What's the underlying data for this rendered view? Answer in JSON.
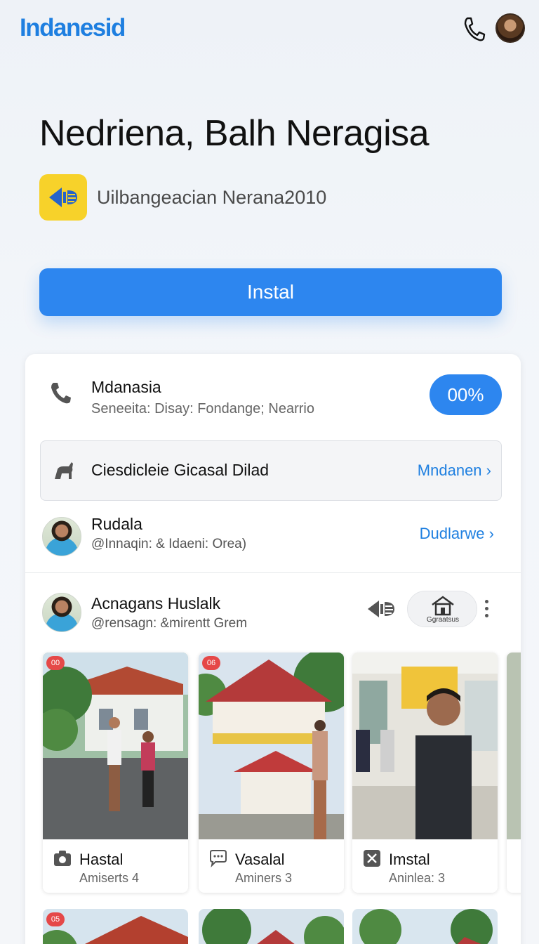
{
  "header": {
    "brand": "Indanesid",
    "icons": [
      "phone-icon",
      "profile-avatar"
    ]
  },
  "app": {
    "title": "Nedriena, Balh Neragisa",
    "developer": "Uilbangeacian Nerana2010",
    "install_label": "Instal"
  },
  "details": {
    "contact": {
      "title": "Mdanasia",
      "subtitle": "Seneeita: Disay: Fondange; Nearrio",
      "percent": "00%"
    },
    "category": {
      "title": "Ciesdicleie Gicasal Dilad",
      "link": "Mndanen"
    },
    "reviewer": {
      "name": "Rudala",
      "handle": "@Innaqin: & Idaeni: Orea)",
      "link": "Dudlarwe"
    },
    "post": {
      "name": "Acnagans Huslalk",
      "handle": "@rensagn: &mirentt Grem",
      "pill_label": "Ggraatsus"
    }
  },
  "gallery": [
    {
      "badge": "00",
      "title": "Hastal",
      "subtitle": "Amiserts 4",
      "icon": "camera-icon"
    },
    {
      "badge": "06",
      "title": "Vasalal",
      "subtitle": "Aminers 3",
      "icon": "chat-icon"
    },
    {
      "badge": "",
      "title": "Imstal",
      "subtitle": "Aninlea: 3",
      "icon": "close-box-icon"
    }
  ],
  "gallery_row2": [
    {
      "badge": "05"
    },
    {
      "badge": ""
    },
    {
      "badge": ""
    }
  ],
  "colors": {
    "accent": "#2d86ef",
    "brand": "#1e7fe0",
    "badge": "#e54848",
    "dev_icon_bg": "#f7d22a"
  }
}
